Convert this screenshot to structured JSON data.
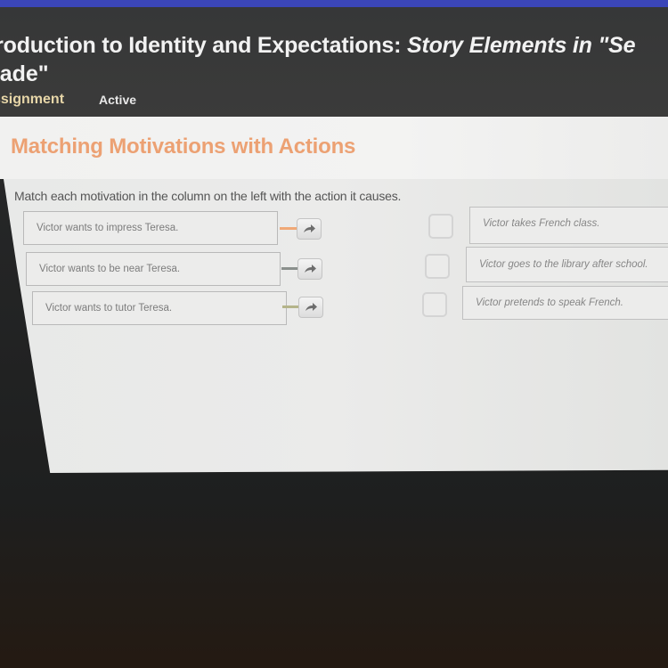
{
  "header": {
    "title_normal": "troduction to Identity and Expectations: ",
    "title_italic": "Story Elements in \"Se",
    "title_line2": "rade\"",
    "subnav_assignment": "ssignment",
    "subnav_status": "Active"
  },
  "activity": {
    "title": "Matching Motivations with Actions",
    "instructions": "Match each motivation in the column on the left with the action it causes."
  },
  "motivations": [
    {
      "label": "Victor wants to impress Teresa.",
      "connector_color": "#f0a877"
    },
    {
      "label": "Victor wants to be near Teresa.",
      "connector_color": "#8a8f8c"
    },
    {
      "label": "Victor wants to tutor Teresa.",
      "connector_color": "#b4b48a"
    }
  ],
  "actions": [
    {
      "label": "Victor takes French class."
    },
    {
      "label": "Victor goes to the library after school."
    },
    {
      "label": "Victor pretends to speak French."
    }
  ],
  "colors": {
    "accent_title": "#eca173",
    "top_strip": "#3b46b8"
  }
}
